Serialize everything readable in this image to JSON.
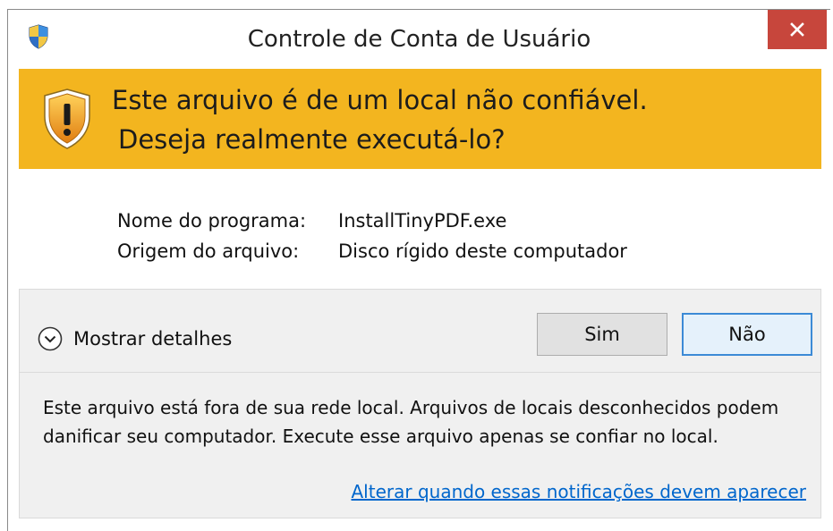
{
  "window": {
    "title": "Controle de Conta de Usuário",
    "close_icon": "close-icon"
  },
  "banner": {
    "line1": "Este arquivo é de um local não confiável.",
    "line2": "Deseja realmente executá-lo?",
    "color": "#f3b51f"
  },
  "info": {
    "program_label": "Nome do programa:",
    "program_value": "InstallTinyPDF.exe",
    "origin_label": "Origem do arquivo:",
    "origin_value": "Disco rígido deste computador"
  },
  "details": {
    "label": "Mostrar detalhes",
    "icon": "chevron-down-circle-icon"
  },
  "buttons": {
    "yes": "Sim",
    "no": "Não"
  },
  "description": "Este arquivo está fora de sua rede local. Arquivos de locais desconhecidos podem danificar seu computador. Execute esse arquivo apenas se confiar no local.",
  "link": "Alterar quando essas notificações devem aparecer",
  "colors": {
    "close_button": "#c7463c",
    "link": "#0066cc",
    "focus_border": "#3c8ad6"
  }
}
